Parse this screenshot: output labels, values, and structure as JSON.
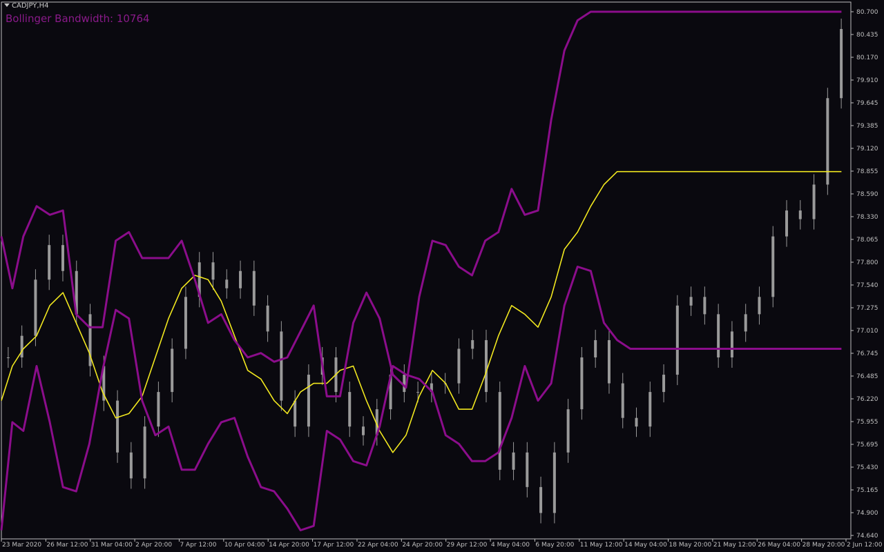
{
  "header": {
    "symbol_label": "CADJPY,H4",
    "indicator_label": "Bollinger Bandwidth: 10764"
  },
  "colors": {
    "background": "#0a090f",
    "candle": "#9a9a9a",
    "middle_band": "#f2e81f",
    "outer_bands": "#8b0d8b",
    "axis_text": "#c0c0c0",
    "frame": "#c0c0c0"
  },
  "chart_data": {
    "type": "line",
    "price_axis": {
      "ylim": [
        74.64,
        80.7
      ],
      "tick_labels": [
        "80.700",
        "80.435",
        "80.170",
        "79.910",
        "79.645",
        "79.385",
        "79.120",
        "78.855",
        "78.590",
        "78.330",
        "78.065",
        "77.800",
        "77.540",
        "77.275",
        "77.010",
        "76.745",
        "76.485",
        "76.220",
        "75.955",
        "75.695",
        "75.430",
        "75.165",
        "74.900",
        "74.640"
      ]
    },
    "time_axis": {
      "tick_labels": [
        "23 Mar 2020",
        "26 Mar 12:00",
        "31 Mar 04:00",
        "2 Apr 20:00",
        "7 Apr 12:00",
        "10 Apr 04:00",
        "14 Apr 20:00",
        "17 Apr 12:00",
        "22 Apr 04:00",
        "24 Apr 20:00",
        "29 Apr 12:00",
        "4 May 04:00",
        "6 May 20:00",
        "11 May 12:00",
        "14 May 04:00",
        "18 May 20:00",
        "21 May 12:00",
        "26 May 04:00",
        "28 May 20:00",
        "2 Jun 12:00"
      ],
      "bar_range": [
        0,
        385
      ]
    },
    "candles_close": [
      76.7,
      76.95,
      77.6,
      78.0,
      77.7,
      77.2,
      76.6,
      76.2,
      75.6,
      75.3,
      75.9,
      76.3,
      76.8,
      77.4,
      77.8,
      77.6,
      77.5,
      77.7,
      77.3,
      77.0,
      76.2,
      75.9,
      76.5,
      76.7,
      76.3,
      75.9,
      75.8,
      76.1,
      76.5,
      76.3,
      76.3,
      76.4,
      76.4,
      76.8,
      76.9,
      76.3,
      75.4,
      75.6,
      75.2,
      74.9,
      75.6,
      76.1,
      76.7,
      76.9,
      76.4,
      76.0,
      75.9,
      76.3,
      76.5,
      77.3,
      77.4,
      77.2,
      76.7,
      77.0,
      77.2,
      77.4,
      78.1,
      78.4,
      78.3,
      78.7,
      79.7,
      80.5
    ],
    "series": [
      {
        "name": "Bollinger Middle",
        "x": [
          0,
          5,
          10,
          16,
          22,
          28,
          34,
          40,
          46,
          52,
          58,
          64,
          70,
          76,
          82,
          88,
          94,
          100,
          106,
          112,
          118,
          124,
          130,
          136,
          142,
          148,
          154,
          160,
          166,
          172,
          178,
          184,
          190,
          196,
          202,
          208,
          214,
          220,
          226,
          232,
          238,
          244,
          250,
          256,
          262,
          268,
          274,
          280,
          286,
          292,
          298,
          304,
          310,
          316,
          322,
          328,
          334,
          340,
          346,
          352,
          358,
          364,
          370,
          376,
          382
        ],
        "values": [
          76.2,
          76.6,
          76.8,
          76.95,
          77.3,
          77.45,
          77.1,
          76.75,
          76.3,
          76.0,
          76.05,
          76.25,
          76.7,
          77.15,
          77.5,
          77.65,
          77.6,
          77.35,
          76.95,
          76.55,
          76.45,
          76.2,
          76.05,
          76.3,
          76.4,
          76.4,
          76.55,
          76.6,
          76.2,
          75.85,
          75.6,
          75.8,
          76.25,
          76.55,
          76.4,
          76.1,
          76.1,
          76.5,
          76.95,
          77.3,
          77.2,
          77.05,
          77.4,
          77.95,
          78.15,
          78.45,
          78.7,
          78.85,
          78.85,
          78.85,
          78.85,
          78.85,
          78.85,
          78.85,
          78.85,
          78.85,
          78.85,
          78.85,
          78.85,
          78.85,
          78.85,
          78.85,
          78.85,
          78.85,
          78.85
        ]
      },
      {
        "name": "Bollinger Upper",
        "x": [
          0,
          5,
          10,
          16,
          22,
          28,
          34,
          40,
          46,
          52,
          58,
          64,
          70,
          76,
          82,
          88,
          94,
          100,
          106,
          112,
          118,
          124,
          130,
          136,
          142,
          148,
          154,
          160,
          166,
          172,
          178,
          184,
          190,
          196,
          202,
          208,
          214,
          220,
          226,
          232,
          238,
          244,
          250,
          256,
          262,
          268,
          274,
          280,
          286,
          292,
          298,
          304,
          310,
          316,
          322,
          328,
          334,
          340,
          346,
          352,
          358,
          364,
          370,
          376,
          382
        ],
        "values": [
          78.1,
          77.5,
          78.1,
          78.45,
          78.35,
          78.4,
          77.2,
          77.05,
          77.05,
          78.05,
          78.15,
          77.85,
          77.85,
          77.85,
          78.05,
          77.6,
          77.1,
          77.2,
          76.9,
          76.7,
          76.75,
          76.65,
          76.7,
          77.0,
          77.3,
          76.25,
          76.25,
          77.1,
          77.45,
          77.15,
          76.5,
          76.35,
          77.4,
          78.05,
          78.0,
          77.75,
          77.65,
          78.05,
          78.15,
          78.65,
          78.35,
          78.4,
          79.45,
          80.25,
          80.6,
          80.7,
          80.7,
          80.7,
          80.7,
          80.7,
          80.7,
          80.7,
          80.7,
          80.7,
          80.7,
          80.7,
          80.7,
          80.7,
          80.7,
          80.7,
          80.7,
          80.7,
          80.7,
          80.7,
          80.7
        ]
      },
      {
        "name": "Bollinger Lower",
        "x": [
          0,
          5,
          10,
          16,
          22,
          28,
          34,
          40,
          46,
          52,
          58,
          64,
          70,
          76,
          82,
          88,
          94,
          100,
          106,
          112,
          118,
          124,
          130,
          136,
          142,
          148,
          154,
          160,
          166,
          172,
          178,
          184,
          190,
          196,
          202,
          208,
          214,
          220,
          226,
          232,
          238,
          244,
          250,
          256,
          262,
          268,
          274,
          280,
          286,
          292,
          298,
          304,
          310,
          316,
          322,
          328,
          334,
          340,
          346,
          352,
          358,
          364,
          370,
          376,
          382
        ],
        "values": [
          74.7,
          75.95,
          75.85,
          76.6,
          75.95,
          75.2,
          75.15,
          75.7,
          76.55,
          77.25,
          77.15,
          76.2,
          75.8,
          75.9,
          75.4,
          75.4,
          75.7,
          75.95,
          76.0,
          75.55,
          75.2,
          75.15,
          74.95,
          74.7,
          74.75,
          75.85,
          75.75,
          75.5,
          75.45,
          75.9,
          76.6,
          76.5,
          76.45,
          76.3,
          75.8,
          75.7,
          75.5,
          75.5,
          75.6,
          76.0,
          76.6,
          76.2,
          76.4,
          77.3,
          77.75,
          77.7,
          77.1,
          76.9,
          76.8,
          76.8,
          76.8,
          76.8,
          76.8,
          76.8,
          76.8,
          76.8,
          76.8,
          76.8,
          76.8,
          76.8,
          76.8,
          76.8,
          76.8,
          76.8,
          76.8
        ]
      }
    ]
  }
}
